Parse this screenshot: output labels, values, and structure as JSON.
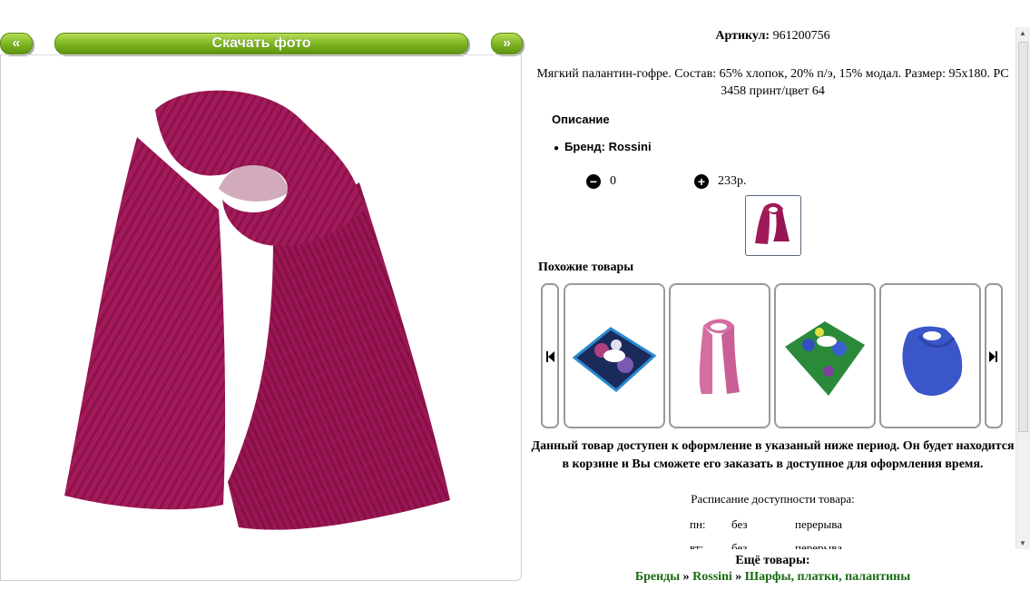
{
  "nav": {
    "prev_label": "«",
    "download_label": "Скачать фото",
    "next_label": "»"
  },
  "product": {
    "sku_label": "Артикул:",
    "sku_value": "961200756",
    "description": "Мягкий палантин-гофре. Состав: 65% хлопок, 20% п/э, 15% модал. Размер: 95x180. PC 3458 принт/цвет 64",
    "description_heading": "Описание",
    "brand_label": "Бренд: Rossini",
    "quantity": "0",
    "price": "233р.",
    "color": "#a01a5a"
  },
  "similar": {
    "heading": "Похожие товары",
    "items": [
      {
        "icon": "floral-scarf-image"
      },
      {
        "icon": "pink-scarf-image"
      },
      {
        "icon": "green-scarf-image"
      },
      {
        "icon": "blue-scarf-image"
      }
    ]
  },
  "availability": {
    "notice": "Данный товар доступен к оформление в указаный ниже период. Он будет находится в корзине и Вы сможете его заказать в доступное для оформления время.",
    "schedule_title": "Расписание доступности товара:",
    "rows": [
      {
        "day": "пн:",
        "a": "без",
        "b": "перерыва"
      },
      {
        "day": "вт:",
        "a": "без",
        "b": "перерыва"
      }
    ]
  },
  "footer": {
    "more_label": "Ещё товары:",
    "crumb_1": "Бренды",
    "sep": "»",
    "crumb_2": "Rossini",
    "crumb_3": "Шарфы, платки, палантины"
  }
}
